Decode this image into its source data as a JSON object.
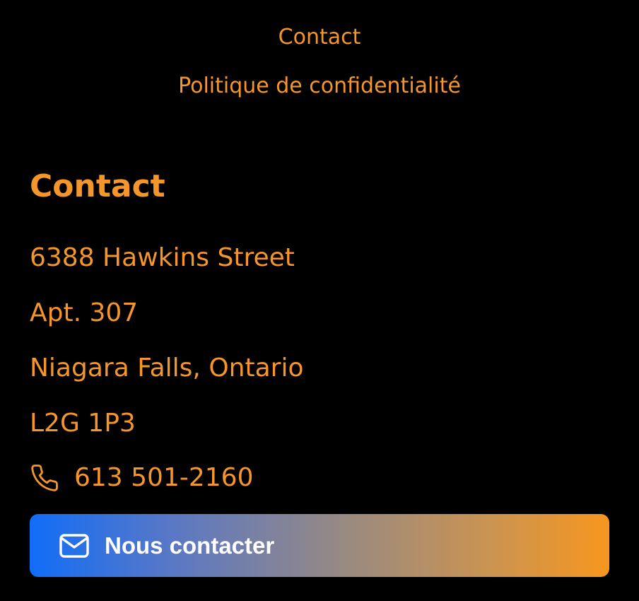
{
  "footer_nav": {
    "links": [
      {
        "label": "Contact"
      },
      {
        "label": "Politique de confidentialité"
      }
    ]
  },
  "contact_section": {
    "title": "Contact",
    "address": {
      "line1": "6388 Hawkins Street",
      "line2": "Apt. 307",
      "line3": "Niagara Falls, Ontario",
      "postal_code": "L2G 1P3"
    },
    "phone": {
      "icon": "phone-icon",
      "number": "613 501-2160"
    },
    "cta_button": {
      "icon": "mail-icon",
      "label": "Nous contacter"
    }
  },
  "colors": {
    "background": "#000000",
    "accent": "#f4962a",
    "button_gradient_start": "#116df8",
    "button_gradient_end": "#f7961f",
    "button_text": "#ffffff"
  }
}
